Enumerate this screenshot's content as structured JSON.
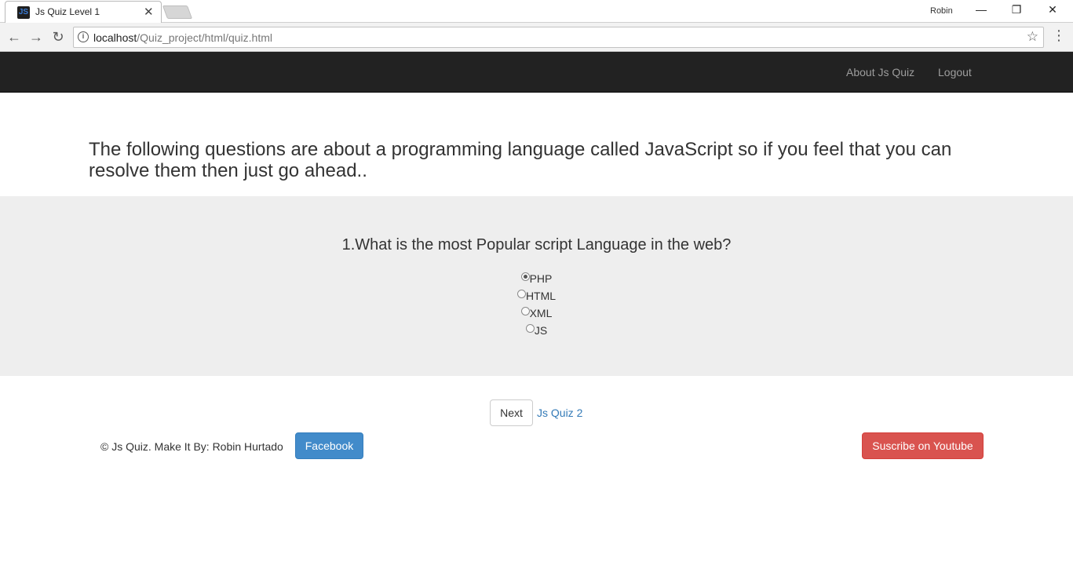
{
  "browser": {
    "tab_title": "Js Quiz Level 1",
    "favicon_text": "JS",
    "profile_name": "Robin",
    "url_host": "localhost",
    "url_path": "/Quiz_project/html/quiz.html"
  },
  "navbar": {
    "links": [
      "About Js Quiz",
      "Logout"
    ]
  },
  "intro_text": "The following questions are about a programming language called JavaScript so if you feel that you can resolve them then just go ahead..",
  "quiz": {
    "question": "1.What is the most Popular script Language in the web?",
    "options": [
      {
        "label": "PHP",
        "selected": true
      },
      {
        "label": "HTML",
        "selected": false
      },
      {
        "label": "XML",
        "selected": false
      },
      {
        "label": "JS",
        "selected": false
      }
    ]
  },
  "actions": {
    "next_label": "Next",
    "quiz2_link": "Js Quiz 2"
  },
  "footer": {
    "copyright": "© Js Quiz. Make It By: Robin Hurtado",
    "facebook_label": "Facebook",
    "youtube_label": "Suscribe on Youtube"
  },
  "colors": {
    "navbar_bg": "#222222",
    "jumbotron_bg": "#eeeeee",
    "facebook_btn": "#428bca",
    "youtube_btn": "#d9534f",
    "link": "#337ab7"
  }
}
